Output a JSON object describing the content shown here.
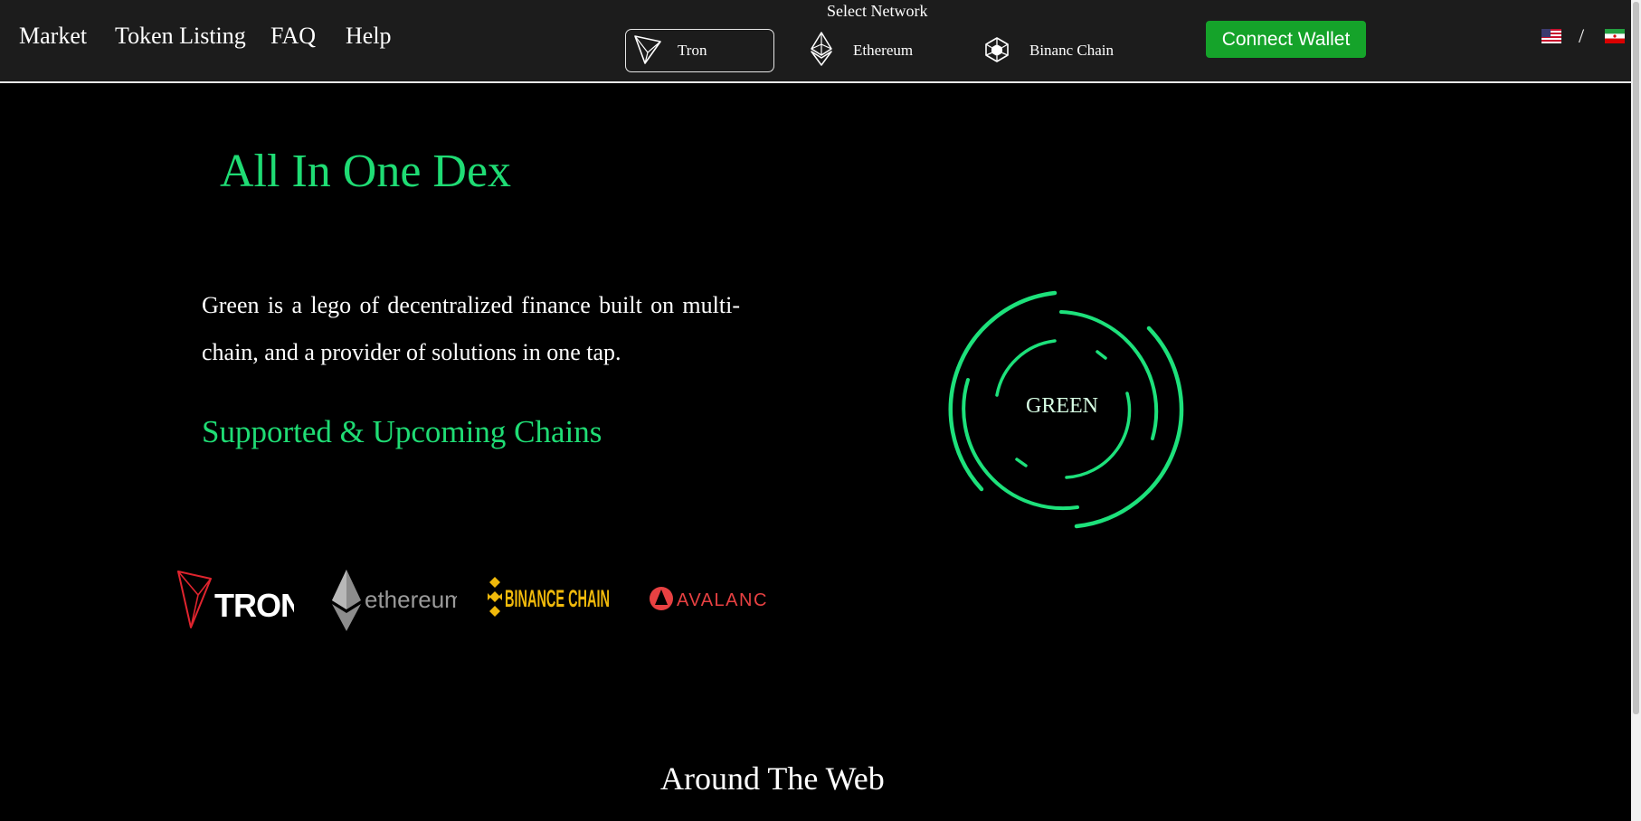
{
  "nav": {
    "items": [
      {
        "label": "Market"
      },
      {
        "label": "Token Listing"
      },
      {
        "label": "FAQ"
      },
      {
        "label": "Help"
      }
    ]
  },
  "network": {
    "label": "Select Network",
    "options": [
      {
        "label": "Tron",
        "icon": "tron-icon",
        "selected": true
      },
      {
        "label": "Ethereum",
        "icon": "ethereum-icon",
        "selected": false
      },
      {
        "label": "Binanc Chain",
        "icon": "binance-icon",
        "selected": false
      }
    ]
  },
  "wallet": {
    "connect_label": "Connect Wallet"
  },
  "language": {
    "separator": "/",
    "flags": [
      "us-flag-icon",
      "iran-flag-icon"
    ]
  },
  "hero": {
    "title": "All In One Dex",
    "description": "Green is a lego of decentralized finance built on multi-chain, and a provider of solutions in one tap.",
    "chains_title": "Supported & Upcoming Chains",
    "ring_label": "GREEN"
  },
  "chains": [
    {
      "name": "TRON",
      "color": "#e0242e"
    },
    {
      "name": "ethereum",
      "color": "#8c8c8c"
    },
    {
      "name": "BINANCE CHAIN",
      "color": "#f0b90b"
    },
    {
      "name": "AVALANCHE",
      "color": "#e84142"
    }
  ],
  "around": {
    "title": "Around The Web"
  },
  "colors": {
    "accent": "#1fdc74",
    "button": "#15a32a",
    "header_bg": "#1c1c1c",
    "background": "#000000"
  }
}
